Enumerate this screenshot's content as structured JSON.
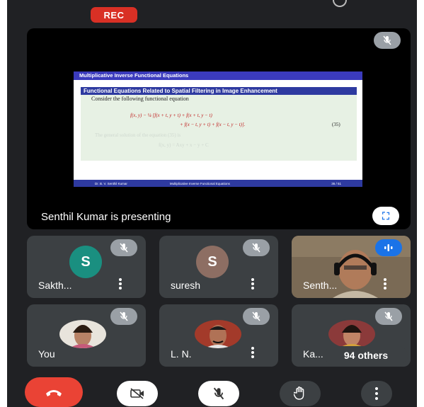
{
  "rec_label": "REC",
  "presenting": {
    "label": "Senthil Kumar is presenting",
    "fullscreen_glyph": "⛶"
  },
  "slide": {
    "header": "Multiplicative Inverse Functional Equations",
    "box_title": "Functional Equations Related to Spatial Filtering in Image Enhancement",
    "intro": "Consider the following functional equation",
    "eq_line1": "f(x, y) − ¼ [f(x + t, y + t) + f(x + t, y − t)",
    "eq_line2": "+ f(x − t, y + t) + f(x − t, y − t)].",
    "eq_number": "(35)",
    "faint_line1": "The general solution of the equation (35) is",
    "faint_line2": "f(x, y) = Axy + x − y + C",
    "footer_author": "Dr. B. V. Senthil Kumar",
    "footer_title": "Multiplicative Inverse Functional Equations",
    "footer_page": "36 / 51"
  },
  "participants": [
    {
      "name": "Sakth...",
      "initial": "S",
      "avatar_color": "#1a8f80"
    },
    {
      "name": "suresh",
      "initial": "S",
      "avatar_color": "#8d6e63"
    },
    {
      "name": "Senth...",
      "speaking": true
    },
    {
      "name": "You"
    },
    {
      "name": "L. N."
    },
    {
      "name": "Ka...",
      "overlay": "94 others"
    }
  ],
  "controls": {
    "end_call": "end-call",
    "camera": "camera-off",
    "mic": "mic-off",
    "hand": "raise-hand",
    "more": "more-options"
  },
  "colors": {
    "background": "#202124",
    "tile": "#3c4043",
    "rec": "#d93025",
    "end_call": "#ea4335",
    "speaking": "#1a73e8"
  }
}
